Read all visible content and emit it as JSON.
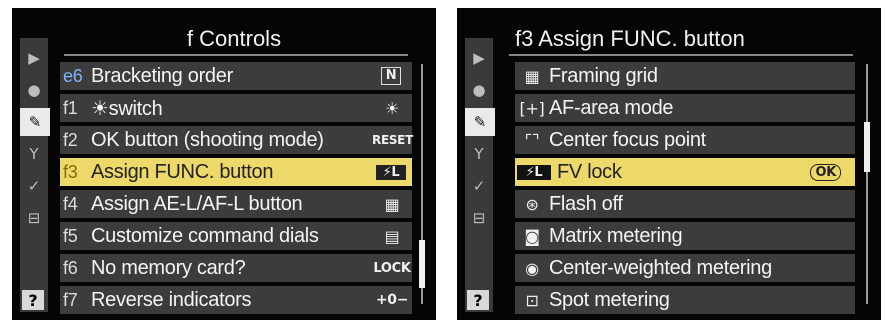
{
  "left": {
    "title": "f  Controls",
    "tabs": [
      "▶",
      "●",
      "✎",
      "Y",
      "✓",
      "⊟"
    ],
    "help": "?",
    "items": [
      {
        "code": "e6",
        "label": "Bracketing order",
        "value": "N"
      },
      {
        "code": "f1",
        "label": "☀switch",
        "value": "☀"
      },
      {
        "code": "f2",
        "label": "OK button (shooting mode)",
        "value": "RESET"
      },
      {
        "code": "f3",
        "label": "Assign FUNC. button",
        "value": "⚡L"
      },
      {
        "code": "f4",
        "label": "Assign AE-L/AF-L button",
        "value": "▦"
      },
      {
        "code": "f5",
        "label": "Customize command dials",
        "value": "▤"
      },
      {
        "code": "f6",
        "label": "No memory card?",
        "value": "LOCK"
      },
      {
        "code": "f7",
        "label": "Reverse indicators",
        "value": "+0−"
      }
    ]
  },
  "right": {
    "title": "f3 Assign FUNC. button",
    "tabs": [
      "▶",
      "●",
      "✎",
      "Y",
      "✓",
      "⊟"
    ],
    "help": "?",
    "ok_label": "OK",
    "items": [
      {
        "icon": "▦",
        "label": "Framing grid"
      },
      {
        "icon": "[+]",
        "label": "AF-area mode"
      },
      {
        "icon": "⌜⌝",
        "label": "Center focus point"
      },
      {
        "icon": "⚡L",
        "label": "FV lock"
      },
      {
        "icon": "⊛",
        "label": "Flash off"
      },
      {
        "icon": "◙",
        "label": "Matrix metering"
      },
      {
        "icon": "◉",
        "label": "Center-weighted metering"
      },
      {
        "icon": "⊡",
        "label": "Spot metering"
      }
    ]
  }
}
